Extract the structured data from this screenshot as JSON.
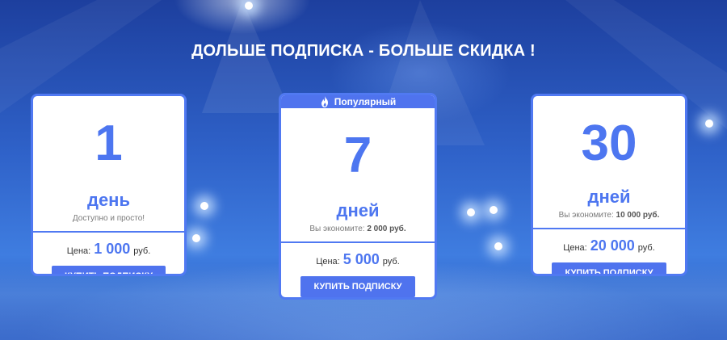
{
  "header": {
    "title": "ДОЛЬШЕ ПОДПИСКА - БОЛЬШЕ СКИДКА !"
  },
  "plans": [
    {
      "number": "1",
      "unit": "день",
      "subtitle": "Доступно и просто!",
      "price_label": "Цена:",
      "price_value": "1 000",
      "currency": "руб.",
      "button_label": "КУПИТЬ ПОДПИСКУ"
    },
    {
      "badge": "Популярный",
      "number": "7",
      "unit": "дней",
      "subtitle_prefix": "Вы экономите:",
      "subtitle_amount": "2 000 руб.",
      "price_label": "Цена:",
      "price_value": "5 000",
      "currency": "руб.",
      "button_label": "КУПИТЬ ПОДПИСКУ"
    },
    {
      "number": "30",
      "unit": "дней",
      "subtitle_prefix": "Вы экономите:",
      "subtitle_amount": "10 000 руб.",
      "price_label": "Цена:",
      "price_value": "20 000",
      "currency": "руб.",
      "button_label": "КУПИТЬ ПОДПИСКУ"
    }
  ],
  "icons": {
    "badge_icon": "flame-icon"
  },
  "colors": {
    "accent": "#4f73ee",
    "number": "#4d76f0",
    "background": "#2f62c9"
  }
}
